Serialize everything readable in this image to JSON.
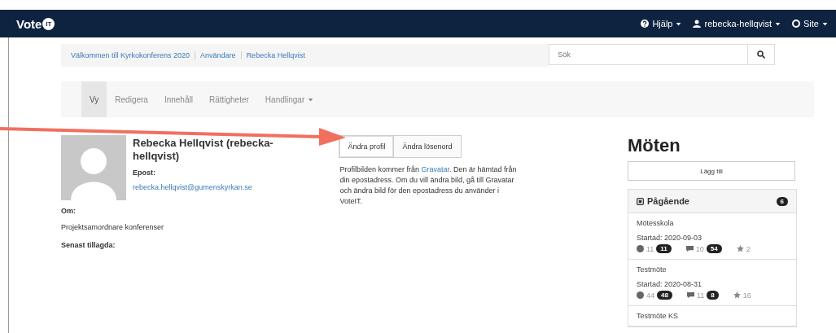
{
  "navbar": {
    "logo": "Vote",
    "logo_badge": "IT",
    "menus": [
      {
        "kind": "help",
        "label": "Hjälp"
      },
      {
        "kind": "user",
        "label": "rebecka-hellqvist"
      },
      {
        "kind": "site",
        "label": "Site"
      }
    ]
  },
  "breadcrumbs": [
    "Välkommen till Kyrkokonferens 2020",
    "Användare",
    "Rebecka Hellqvist"
  ],
  "search": {
    "placeholder": "Sök"
  },
  "tabs": [
    {
      "label": "Vy",
      "selected": true,
      "dropdown": false
    },
    {
      "label": "Redigera",
      "selected": false,
      "dropdown": false
    },
    {
      "label": "Innehåll",
      "selected": false,
      "dropdown": false
    },
    {
      "label": "Rättigheter",
      "selected": false,
      "dropdown": false
    },
    {
      "label": "Handlingar",
      "selected": false,
      "dropdown": true
    }
  ],
  "profile": {
    "name": "Rebecka Hellqvist (rebecka-hellqvist)",
    "email_label": "Epost:",
    "email": "rebecka.hellqvist@gumenskyrkan.se",
    "about_label": "Om:",
    "about": "Projektsamordnare konferenser",
    "last_label": "Senast tillagda:"
  },
  "profile_buttons": [
    {
      "label": "Ändra profil",
      "selected": true
    },
    {
      "label": "Ändra lösenord",
      "selected": false
    }
  ],
  "gravatar_note": {
    "before": "Profilbilden kommer från ",
    "link": "Gravatar",
    "after": ". Den är hämtad från din epostadress. Om du vill ändra bild, gå till Gravatar och ändra bild för den epostadress du använder i VoteIT."
  },
  "meetings": {
    "title": "Möten",
    "add_button": "Lägg till",
    "panel_title": "Pågående",
    "panel_count": "6",
    "items": [
      {
        "name": "Mötesskola",
        "started": "Startad: 2020-09-03",
        "proposals": "11",
        "proposals_badge": "11",
        "comments": "10",
        "comments_badge": "54",
        "stars": "2"
      },
      {
        "name": "Testmöte",
        "started": "Startad: 2020-08-31",
        "proposals": "44",
        "proposals_badge": "48",
        "comments": "11",
        "comments_badge": "8",
        "stars": "16"
      },
      {
        "name": "Testmöte KS"
      }
    ]
  }
}
